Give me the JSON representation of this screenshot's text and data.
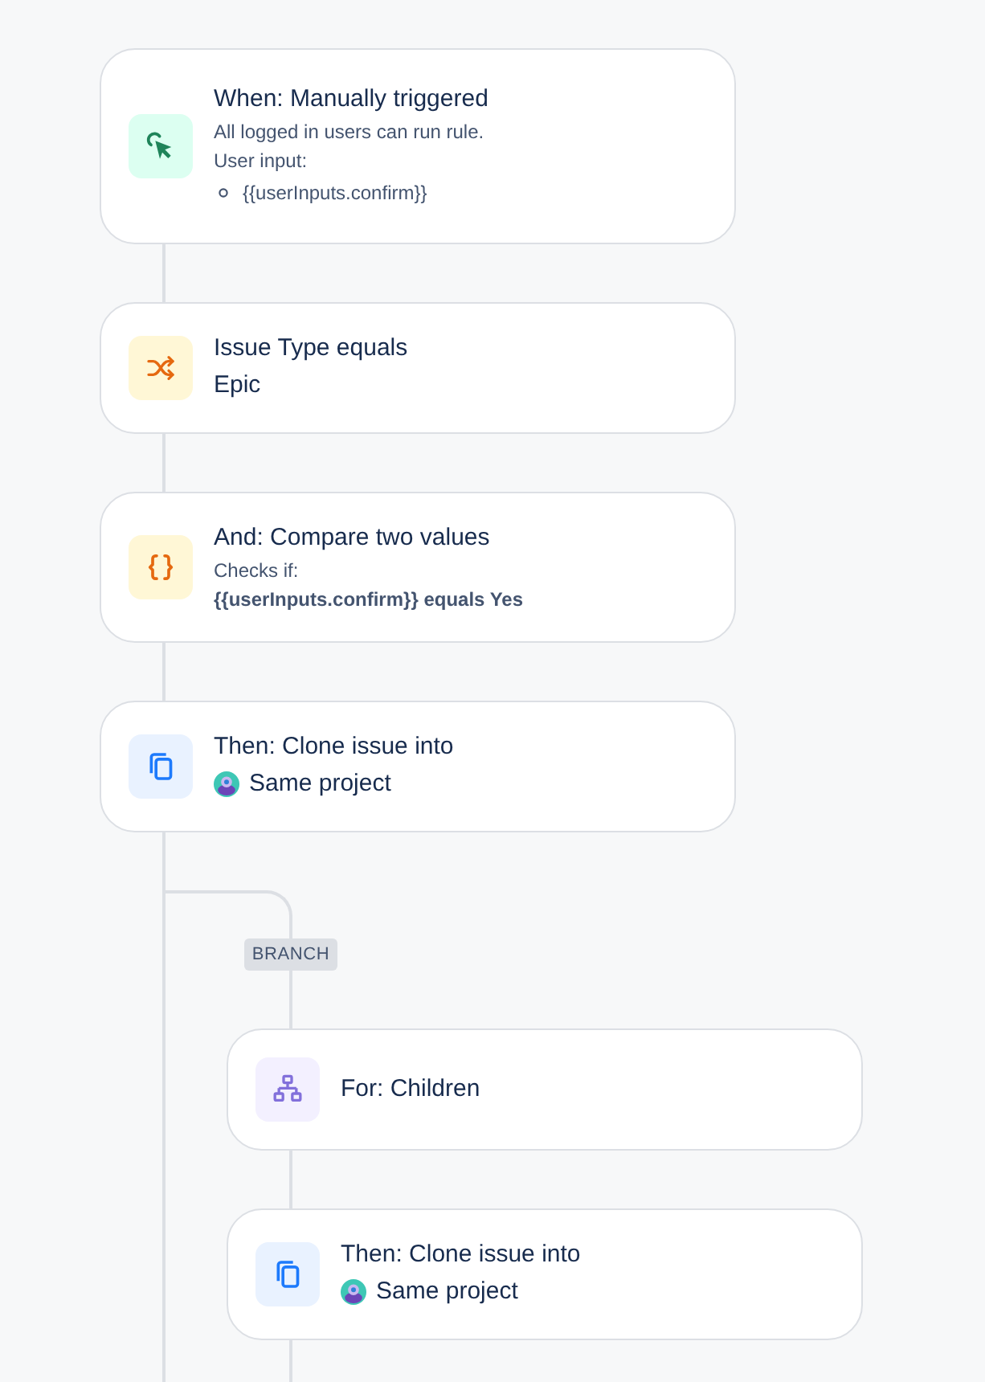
{
  "steps": [
    {
      "kind": "trigger",
      "title": "When: Manually triggered",
      "notes": [
        "All logged in users can run rule.",
        "User input:"
      ],
      "inputs": [
        "{{userInputs.confirm}}"
      ]
    },
    {
      "kind": "condition",
      "title": "Issue Type equals",
      "value": "Epic"
    },
    {
      "kind": "compare",
      "title": "And: Compare two values",
      "notes": [
        "Checks if:"
      ],
      "expression": "{{userInputs.confirm}} equals Yes"
    },
    {
      "kind": "action",
      "title": "Then: Clone issue into",
      "project": "Same project"
    }
  ],
  "branch": {
    "label": "BRANCH",
    "steps": [
      {
        "kind": "loop",
        "title": "For: Children"
      },
      {
        "kind": "action",
        "title": "Then: Clone issue into",
        "project": "Same project"
      }
    ]
  }
}
